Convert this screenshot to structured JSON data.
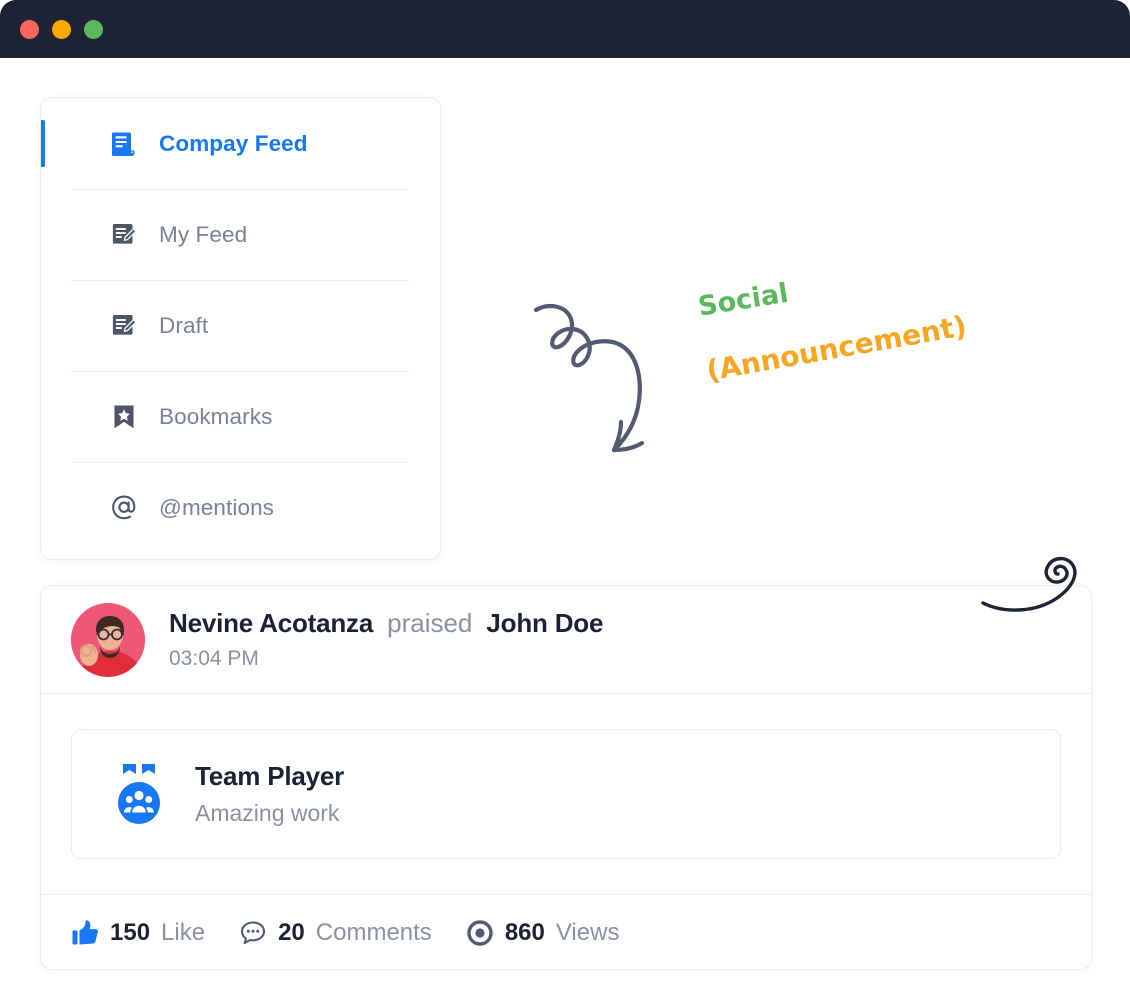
{
  "window": {
    "traffic_lights": [
      {
        "name": "close",
        "color": "#fa6659"
      },
      {
        "name": "minimize",
        "color": "#ffa800"
      },
      {
        "name": "maximize",
        "color": "#5cb85c"
      }
    ],
    "titlebar_color": "#1e2335"
  },
  "sidebar": {
    "items": [
      {
        "label": "Compay Feed",
        "icon": "news-document-icon",
        "active": true
      },
      {
        "label": "My Feed",
        "icon": "document-pencil-icon",
        "active": false
      },
      {
        "label": "Draft",
        "icon": "document-pencil-icon",
        "active": false
      },
      {
        "label": "Bookmarks",
        "icon": "bookmark-star-icon",
        "active": false
      },
      {
        "label": "@mentions",
        "icon": "at-mention-icon",
        "active": false
      }
    ],
    "active_color": "#1877f2",
    "inactive_color": "#7b8099"
  },
  "annotation": {
    "line1": "Social",
    "line2": "(Announcement)",
    "line1_color": "#5cb85c",
    "line2_color": "#f5a623",
    "arrow_color": "#525b72"
  },
  "post": {
    "actor": "Nevine Acotanza",
    "verb": "praised",
    "target": "John Doe",
    "time": "03:04 PM",
    "avatar": "user-avatar-photo",
    "badge": {
      "name": "Team Player",
      "description": "Amazing work",
      "icon": "medal-team-icon",
      "icon_color": "#1877f2"
    },
    "stats": [
      {
        "icon": "thumbs-up-icon",
        "count": "150",
        "label": "Like",
        "icon_color": "#1877f2"
      },
      {
        "icon": "comment-bubble-icon",
        "count": "20",
        "label": "Comments",
        "icon_color": "#525b72"
      },
      {
        "icon": "eye-views-icon",
        "count": "860",
        "label": "Views",
        "icon_color": "#525b72"
      }
    ]
  },
  "decoration": {
    "swirl": "ink-swirl-flourish"
  }
}
